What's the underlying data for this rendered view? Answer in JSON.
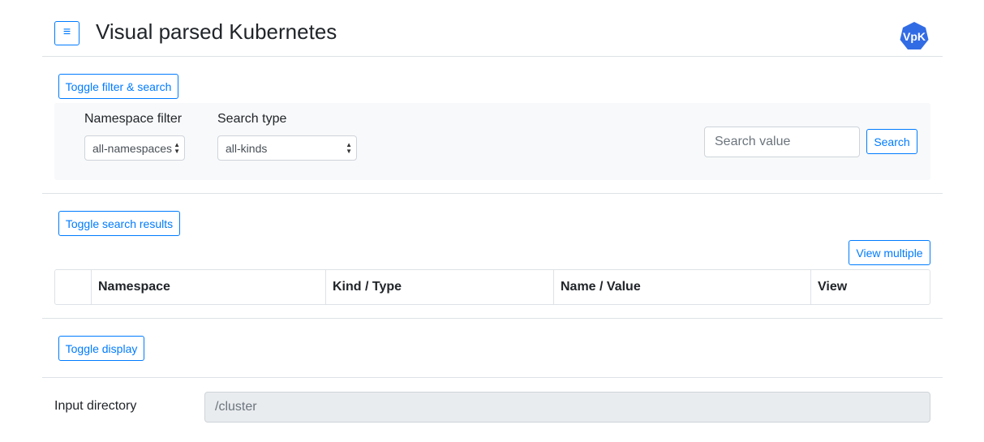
{
  "header": {
    "menu_icon": "hamburger-icon",
    "menu_glyph": "≡",
    "title": "Visual parsed Kubernetes",
    "logo_text": "VpK",
    "logo_color": "#326ce5"
  },
  "filter": {
    "toggle_label": "Toggle filter & search",
    "namespace_label": "Namespace filter",
    "namespace_value": "all-namespaces",
    "search_type_label": "Search type",
    "search_type_value": "all-kinds",
    "search_placeholder": "Search value",
    "search_button": "Search"
  },
  "results": {
    "toggle_label": "Toggle search results",
    "view_multiple_label": "View multiple",
    "columns": [
      "",
      "Namespace",
      "Kind / Type",
      "Name / Value",
      "View"
    ]
  },
  "display": {
    "toggle_label": "Toggle display",
    "input_dir_label": "Input directory",
    "input_dir_value": "/cluster"
  },
  "colors": {
    "accent": "#007bff",
    "panel_bg": "#f8f9fa",
    "readonly_bg": "#e9ecef"
  }
}
